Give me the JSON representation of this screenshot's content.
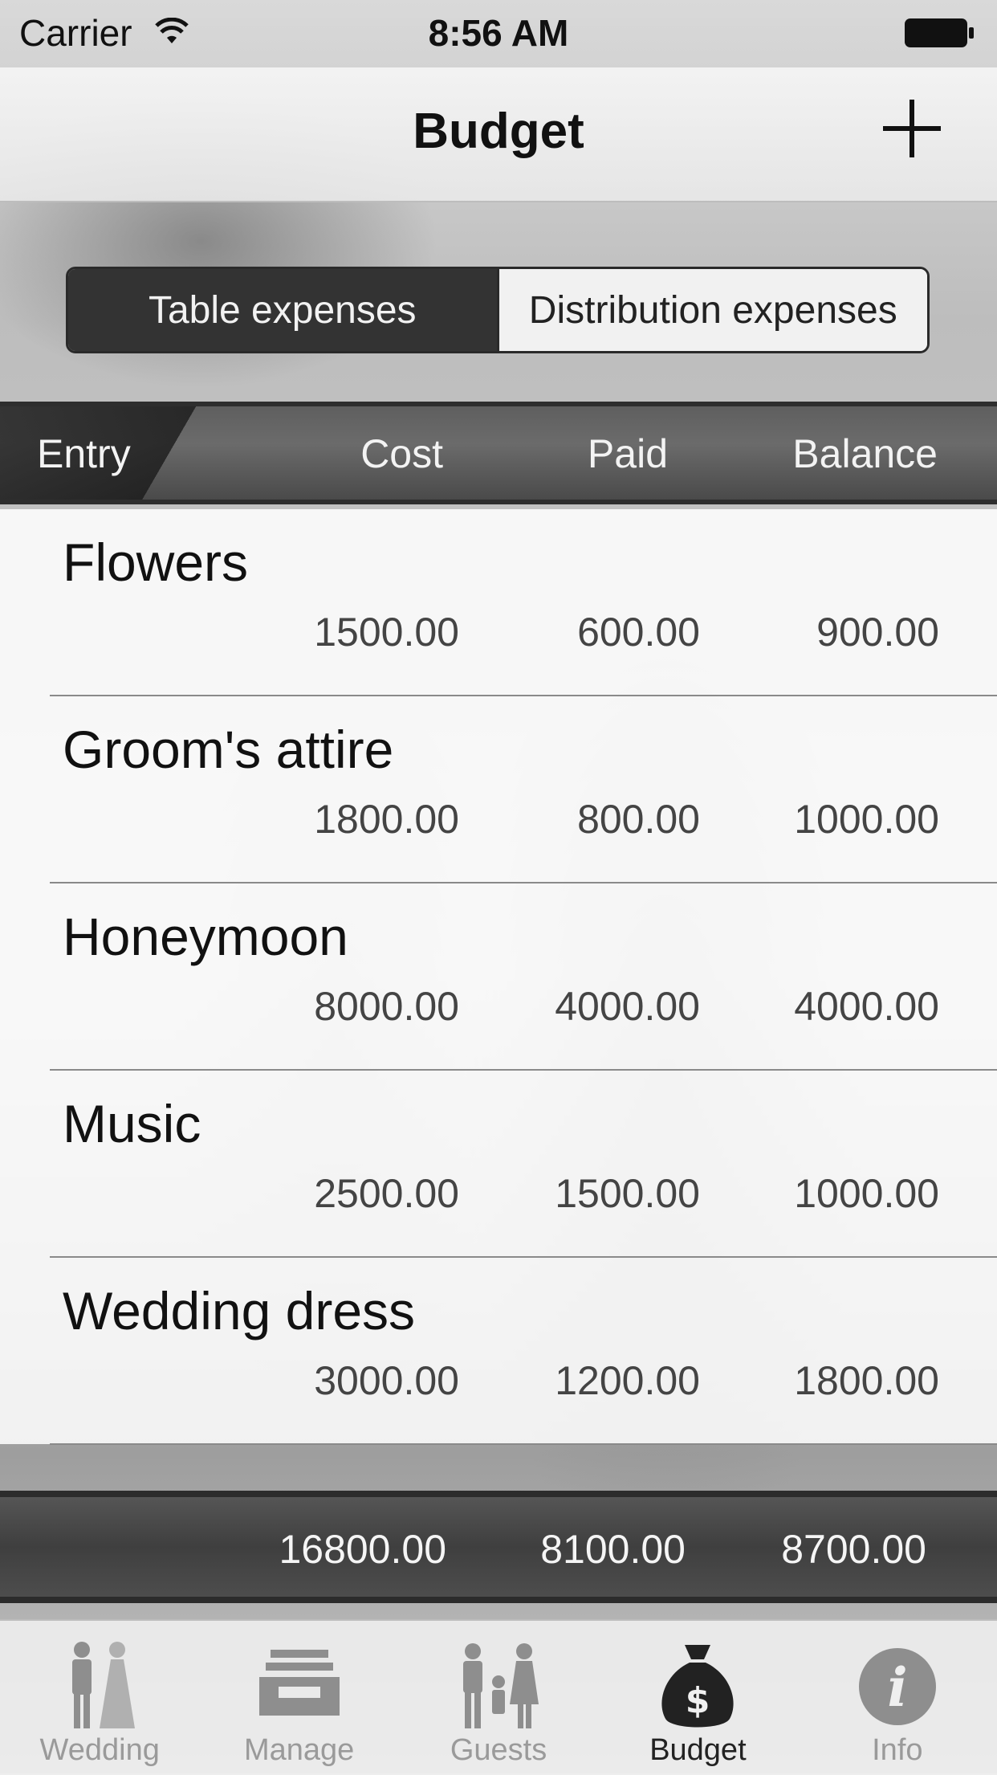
{
  "status": {
    "carrier": "Carrier",
    "time": "8:56 AM"
  },
  "nav": {
    "title": "Budget"
  },
  "segment": {
    "left": "Table expenses",
    "right": "Distribution expenses"
  },
  "header": {
    "entry": "Entry",
    "cost": "Cost",
    "paid": "Paid",
    "balance": "Balance"
  },
  "rows": [
    {
      "name": "Flowers",
      "cost": "1500.00",
      "paid": "600.00",
      "balance": "900.00"
    },
    {
      "name": "Groom's attire",
      "cost": "1800.00",
      "paid": "800.00",
      "balance": "1000.00"
    },
    {
      "name": "Honeymoon",
      "cost": "8000.00",
      "paid": "4000.00",
      "balance": "4000.00"
    },
    {
      "name": "Music",
      "cost": "2500.00",
      "paid": "1500.00",
      "balance": "1000.00"
    },
    {
      "name": "Wedding dress",
      "cost": "3000.00",
      "paid": "1200.00",
      "balance": "1800.00"
    }
  ],
  "totals": {
    "cost": "16800.00",
    "paid": "8100.00",
    "balance": "8700.00"
  },
  "tabs": [
    {
      "label": "Wedding",
      "icon": "couple-icon"
    },
    {
      "label": "Manage",
      "icon": "inbox-tray-icon"
    },
    {
      "label": "Guests",
      "icon": "family-icon"
    },
    {
      "label": "Budget",
      "icon": "money-bag-icon",
      "active": true
    },
    {
      "label": "Info",
      "icon": "info-icon"
    }
  ]
}
